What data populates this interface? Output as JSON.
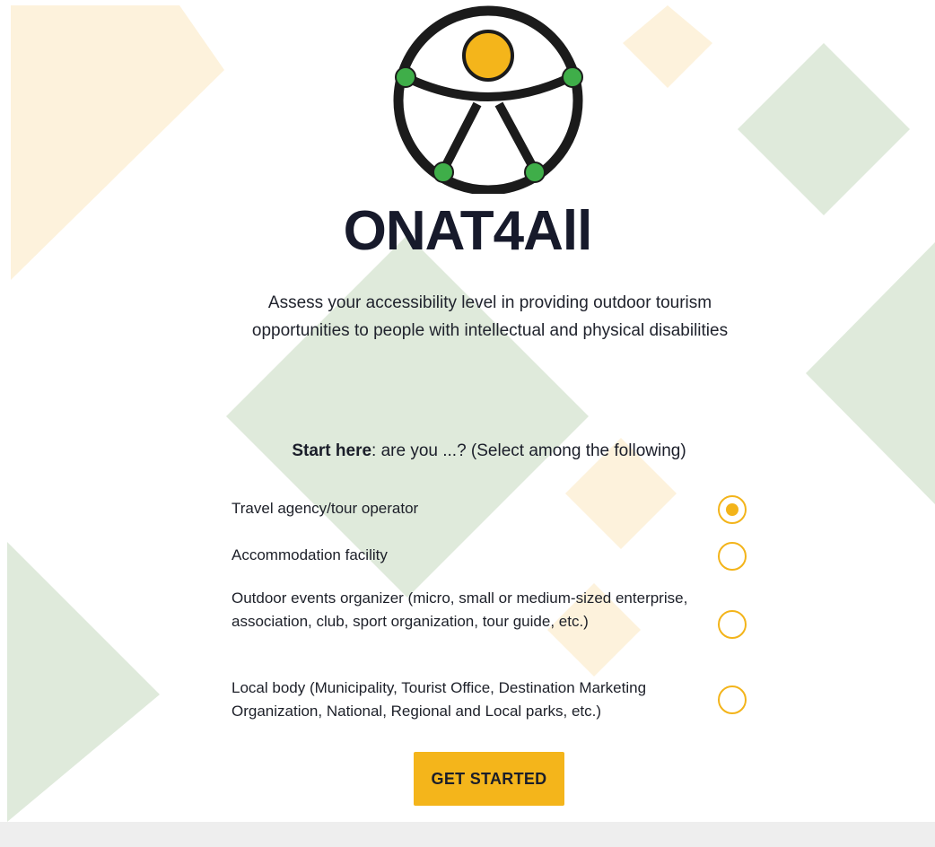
{
  "brand": {
    "name": "ONAT4All"
  },
  "intro": {
    "tagline": "Assess your accessibility level in providing outdoor tourism opportunities to people with intellectual and physical disabilities"
  },
  "question": {
    "lead": "Start here",
    "rest": ": are you ...? (Select among the following)"
  },
  "options": [
    {
      "label": "Travel agency/tour operator",
      "selected": true
    },
    {
      "label": "Accommodation facility",
      "selected": false
    },
    {
      "label": "Outdoor events organizer (micro, small or medium-sized enterprise, association, club, sport organization, tour guide, etc.)",
      "selected": false
    },
    {
      "label": "Local body (Municipality, Tourist Office, Destination Marketing Organization, National, Regional and Local parks, etc.)",
      "selected": false
    }
  ],
  "cta": {
    "label": "GET STARTED"
  },
  "colors": {
    "accent": "#f4b51b",
    "green_shape": "#dfeadb",
    "yellow_shape": "#fdf2dc",
    "logo_dark": "#1b1b1b",
    "logo_green": "#3fae49"
  }
}
